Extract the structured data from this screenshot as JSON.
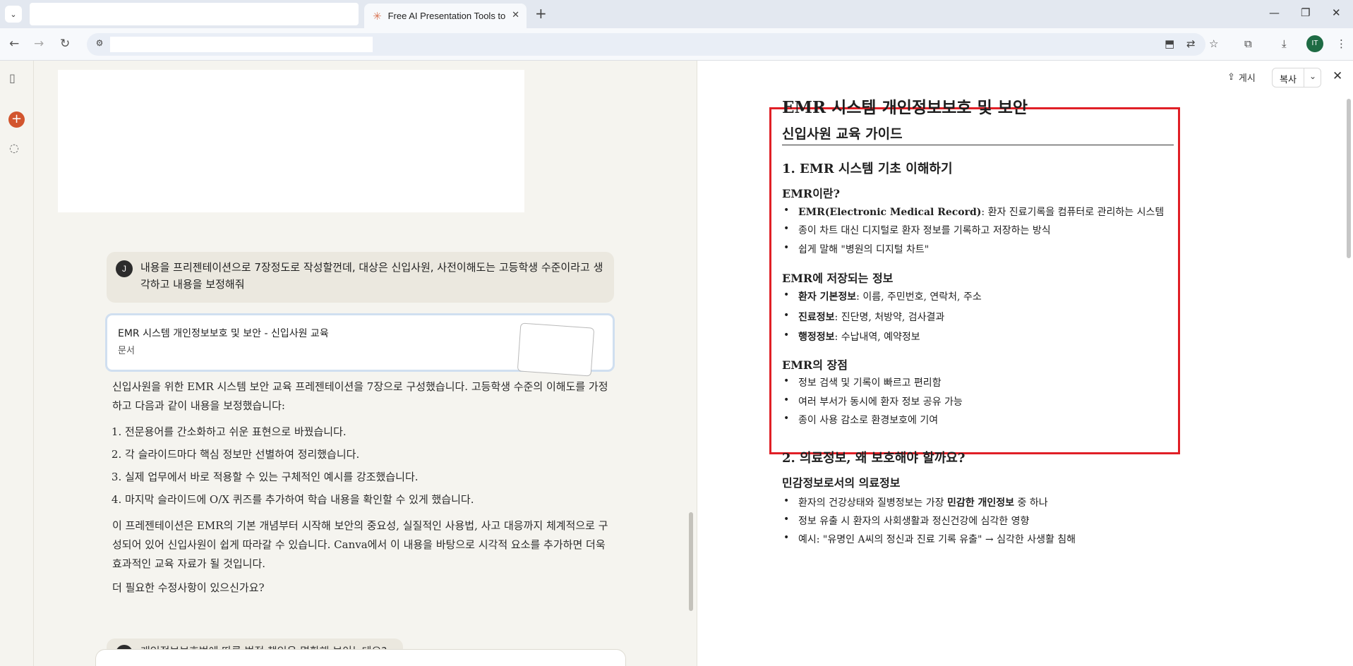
{
  "browser": {
    "active_tab_title": "Free AI Presentation Tools to E",
    "tab_close": "✕",
    "new_tab": "+",
    "window_controls": [
      "—",
      "❐",
      "✕"
    ]
  },
  "chat": {
    "user_avatar_initial": "J",
    "user_message": "내용을 프리젠테이션으로 7장정도로 작성할껀데, 대상은 신입사원, 사전이해도는 고등학생 수준이라고 생각하고 내용을 보정해줘",
    "doc_card": {
      "title": "EMR 시스템 개인정보보호 및 보안 - 신입사원 교육",
      "type": "문서"
    },
    "assistant": {
      "intro": "신입사원을 위한 EMR 시스템 보안 교육 프레젠테이션을 7장으로 구성했습니다. 고등학생 수준의 이해도를 가정하고 다음과 같이 내용을 보정했습니다:",
      "points": [
        "전문용어를 간소화하고 쉬운 표현으로 바꿨습니다.",
        "각 슬라이드마다 핵심 정보만 선별하여 정리했습니다.",
        "실제 업무에서 바로 적용할 수 있는 구체적인 예시를 강조했습니다.",
        "마지막 슬라이드에 O/X 퀴즈를 추가하여 학습 내용을 확인할 수 있게 했습니다."
      ],
      "summary": "이 프레젠테이션은 EMR의 기본 개념부터 시작해 보안의 중요성, 실질적인 사용법, 사고 대응까지 체계적으로 구성되어 있어 신입사원이 쉽게 따라갈 수 있습니다. Canva에서 이 내용을 바탕으로 시각적 요소를 추가하면 더욱 효과적인 교육 자료가 될 것입니다.",
      "closing": "더 필요한 수정사항이 있으신가요?"
    },
    "next_message": "개인정보보호법에 따른 법적 책임은 명확해 보이는데요?"
  },
  "panel": {
    "share_label": "게시",
    "copy_label": "복사",
    "document": {
      "title": "EMR 시스템 개인정보보호 및 보안",
      "subtitle": "신입사원 교육 가이드",
      "s1": {
        "heading": "1. EMR 시스템 기초 이해하기",
        "what_heading": "EMR이란?",
        "what_items": [
          {
            "bold": "EMR(Electronic Medical Record)",
            "text": ": 환자 진료기록을 컴퓨터로 관리하는 시스템"
          },
          {
            "bold": "",
            "text": "종이 차트 대신 디지털로 환자 정보를 기록하고 저장하는 방식"
          },
          {
            "bold": "",
            "text": "쉽게 말해 \"병원의 디지털 차트\""
          }
        ],
        "stored_heading": "EMR에 저장되는 정보",
        "stored_items": [
          {
            "bold": "환자 기본정보",
            "text": ": 이름, 주민번호, 연락처, 주소"
          },
          {
            "bold": "진료정보",
            "text": ": 진단명, 처방약, 검사결과"
          },
          {
            "bold": "행정정보",
            "text": ": 수납내역, 예약정보"
          }
        ],
        "merits_heading": "EMR의 장점",
        "merits_items": [
          {
            "bold": "",
            "text": "정보 검색 및 기록이 빠르고 편리함"
          },
          {
            "bold": "",
            "text": "여러 부서가 동시에 환자 정보 공유 가능"
          },
          {
            "bold": "",
            "text": "종이 사용 감소로 환경보호에 기여"
          }
        ]
      },
      "s2": {
        "heading": "2. 의료정보, 왜 보호해야 할까요?",
        "sensitive_heading": "민감정보로서의 의료정보",
        "sensitive_items": [
          {
            "pre": "환자의 건강상태와 질병정보는 가장 ",
            "bold": "민감한 개인정보",
            "post": " 중 하나"
          },
          {
            "pre": "정보 유출 시 환자의 사회생활과 정신건강에 심각한 영향",
            "bold": "",
            "post": ""
          },
          {
            "pre": "예시: \"유명인 A씨의 정신과 진료 기록 유출\" → 심각한 사생활 침해",
            "bold": "",
            "post": ""
          }
        ]
      }
    }
  },
  "colors": {
    "accent": "#d2552e",
    "highlight_border": "#e01f26",
    "chat_bg": "#f5f4ef",
    "profile": "#1e6b44"
  },
  "icons": {
    "tab_list": "chevron-down-icon",
    "favicon": "claude-logo-icon",
    "back": "arrow-left-icon",
    "forward": "arrow-right-icon",
    "reload": "reload-icon",
    "site_settings": "tune-icon",
    "install": "install-app-icon",
    "translate": "translate-icon",
    "bookmark": "star-icon",
    "extensions": "puzzle-icon",
    "downloads": "download-icon",
    "menu": "kebab-menu-icon",
    "sidebar_toggle": "sidebar-toggle-icon",
    "new_chat": "plus-icon",
    "chats": "chat-bubble-icon",
    "share": "share-icon",
    "close": "close-icon"
  }
}
